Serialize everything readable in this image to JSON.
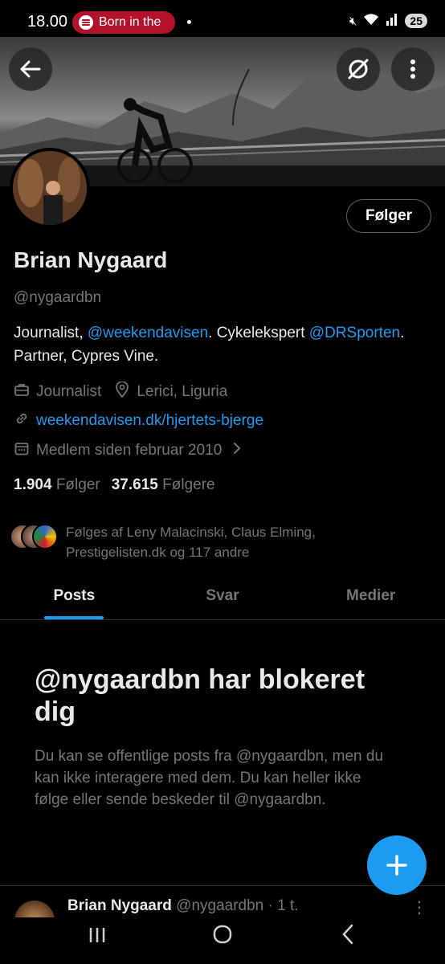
{
  "status_bar": {
    "time": "18.00",
    "now_playing": "Born in the",
    "battery": "25"
  },
  "profile": {
    "name": "Brian Nygaard",
    "handle": "@nygaardbn",
    "follow_button": "Følger",
    "bio_part1": "Journalist, ",
    "bio_mention1": "@weekendavisen",
    "bio_part2": ". Cykelekspert ",
    "bio_mention2": "@DRSporten",
    "bio_part3": ". Partner, Cypres Vine.",
    "job": "Journalist",
    "location": "Lerici, Liguria",
    "website": "weekendavisen.dk/hjertets-bjerge",
    "joined": "Medlem siden februar 2010",
    "following_count": "1.904",
    "following_label": "Følger",
    "followers_count": "37.615",
    "followers_label": "Følgere",
    "followed_by": "Følges af Leny Malacinski, Claus Elming, Prestigelisten.dk og 117 andre"
  },
  "tabs": [
    {
      "label": "Posts",
      "active": true
    },
    {
      "label": "Svar",
      "active": false
    },
    {
      "label": "Medier",
      "active": false
    }
  ],
  "blocked": {
    "title": "@nygaardbn har blokeret dig",
    "description": "Du kan se offentlige posts fra @nygaardbn, men du kan ikke interagere med dem. Du kan heller ikke følge eller sende beskeder til @nygaardbn."
  },
  "post_preview": {
    "name": "Brian Nygaard",
    "meta": "@nygaardbn · 1 t."
  },
  "colors": {
    "accent": "#1d9bf0",
    "muted": "#71767b",
    "spotify_pill": "#b2132a"
  }
}
